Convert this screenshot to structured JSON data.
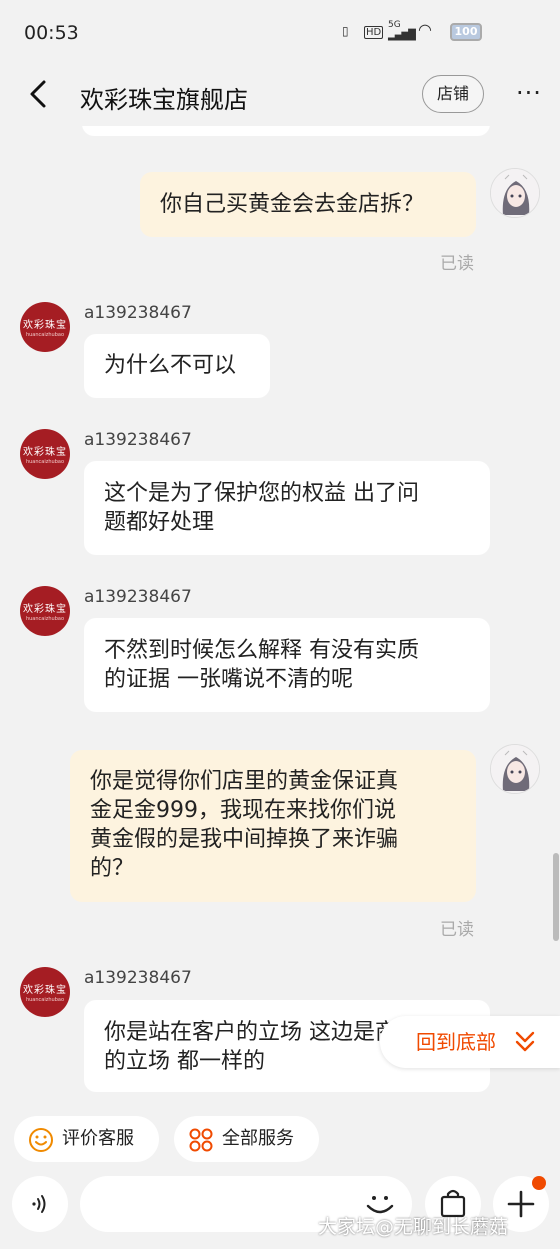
{
  "status_bar": {
    "time": "00:53",
    "network": "5G",
    "hd": "HD",
    "battery": "100"
  },
  "header": {
    "title": "欢彩珠宝旗舰店",
    "shop_button": "店铺",
    "more": "···"
  },
  "shop_avatar": {
    "logo_text": "欢彩珠宝",
    "logo_sub": "huancaizhubao"
  },
  "messages": [
    {
      "from": "me",
      "text": "你自己买黄金会去金店拆？",
      "read": "已读"
    },
    {
      "from": "shop",
      "user": "a139238467",
      "text": "为什么不可以"
    },
    {
      "from": "shop",
      "user": "a139238467",
      "lines": [
        "这个是为了保护您的权益 出了问",
        "题都好处理"
      ]
    },
    {
      "from": "shop",
      "user": "a139238467",
      "lines": [
        "不然到时候怎么解释 有没有实质",
        "的证据 一张嘴说不清的呢"
      ]
    },
    {
      "from": "me",
      "lines": [
        "你是觉得你们店里的黄金保证真",
        "金足金999，我现在来找你们说",
        "黄金假的是我中间掉换了来诈骗",
        "的？"
      ],
      "read": "已读"
    },
    {
      "from": "shop",
      "user": "a139238467",
      "lines": [
        "你是站在客户的立场 这边是商家",
        "的立场 都一样的"
      ]
    }
  ],
  "scroll_to_bottom": "回到底部",
  "quick_actions": [
    {
      "label": "评价客服",
      "icon": "smile-icon"
    },
    {
      "label": "全部服务",
      "icon": "grid-icon"
    }
  ],
  "input": {
    "placeholder": ""
  },
  "watermark": "大家坛@无聊到长蘑菇",
  "colors": {
    "accent": "#f04a00",
    "my_bubble": "#fdf3df",
    "shop_avatar": "#a51d23"
  }
}
